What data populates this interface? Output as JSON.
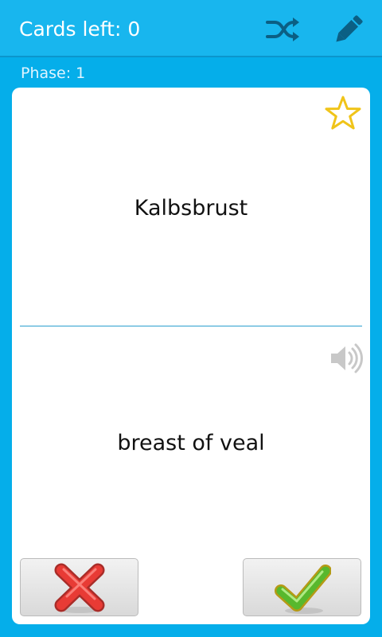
{
  "header": {
    "title": "Cards left: 0",
    "shuffle_icon": "shuffle-icon",
    "edit_icon": "pencil-icon"
  },
  "phase_label": "Phase: 1",
  "card": {
    "front": "Kalbsbrust",
    "back": "breast of veal",
    "favorite_icon": "star-outline-icon",
    "audio_icon": "speaker-icon"
  },
  "actions": {
    "wrong_icon": "red-x-icon",
    "correct_icon": "green-check-icon"
  },
  "colors": {
    "background": "#05aeea",
    "topbar": "#18b6ee",
    "star": "#f0c419",
    "wrong": "#e83b35",
    "correct": "#58b82d"
  }
}
